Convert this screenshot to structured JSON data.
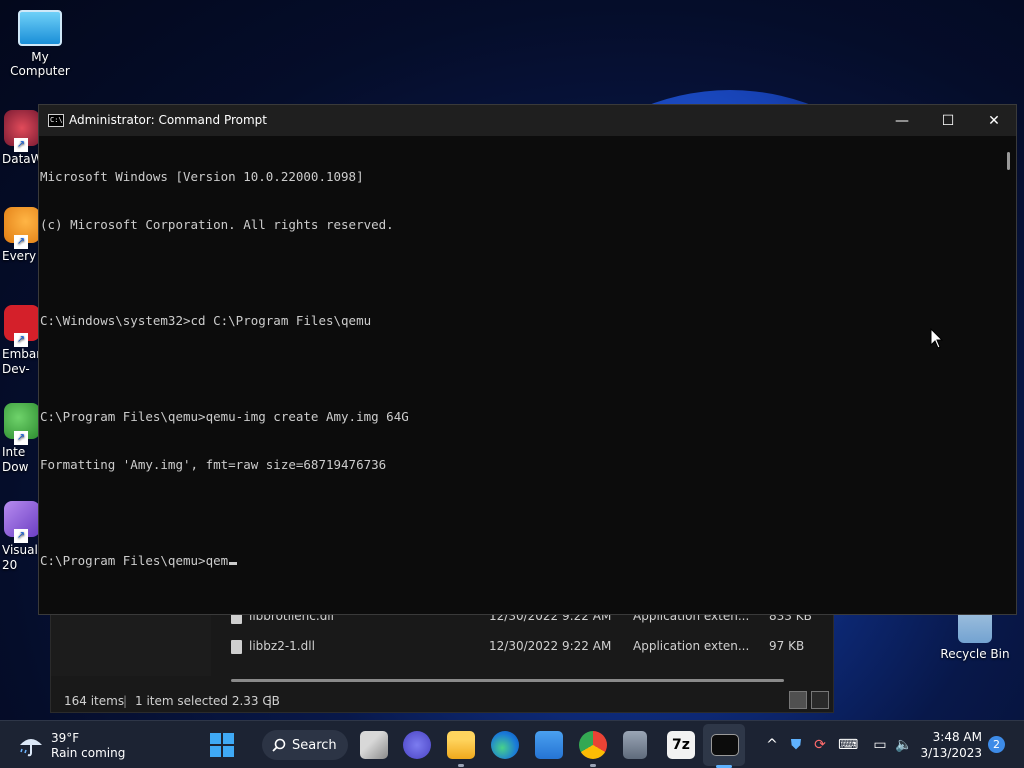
{
  "desktop": {
    "icons": [
      {
        "label": "My Computer"
      },
      {
        "label": "DataW"
      },
      {
        "label": "Every"
      },
      {
        "label": "Embar\nDev-"
      },
      {
        "label": "Inte\nDow"
      },
      {
        "label": "Visual\n20"
      },
      {
        "label": "Recycle Bin"
      }
    ]
  },
  "cmd": {
    "title": "Administrator: Command Prompt",
    "icon_text": "C:\\",
    "lines": [
      "Microsoft Windows [Version 10.0.22000.1098]",
      "(c) Microsoft Corporation. All rights reserved.",
      "",
      "C:\\Windows\\system32>cd C:\\Program Files\\qemu",
      "",
      "C:\\Program Files\\qemu>qemu-img create Amy.img 64G",
      "Formatting 'Amy.img', fmt=raw size=68719476736",
      "",
      "C:\\Program Files\\qemu>qem"
    ],
    "controls": {
      "minimize": "—",
      "maximize": "☐",
      "close": "✕"
    }
  },
  "explorer": {
    "rows": [
      {
        "name": "libbrotlienc.dll",
        "date": "12/30/2022 9:22 AM",
        "type": "Application exten...",
        "size": "833 KB"
      },
      {
        "name": "libbz2-1.dll",
        "date": "12/30/2022 9:22 AM",
        "type": "Application exten...",
        "size": "97 KB"
      }
    ],
    "status": {
      "items": "164 items",
      "selected": "1 item selected  2.33 GB"
    }
  },
  "taskbar": {
    "weather": {
      "temp": "39°F",
      "condition": "Rain coming"
    },
    "search_label": "Search",
    "clock": {
      "time": "3:48 AM",
      "date": "3/13/2023"
    },
    "notifications": "2",
    "sevenzip_label": "7z"
  }
}
